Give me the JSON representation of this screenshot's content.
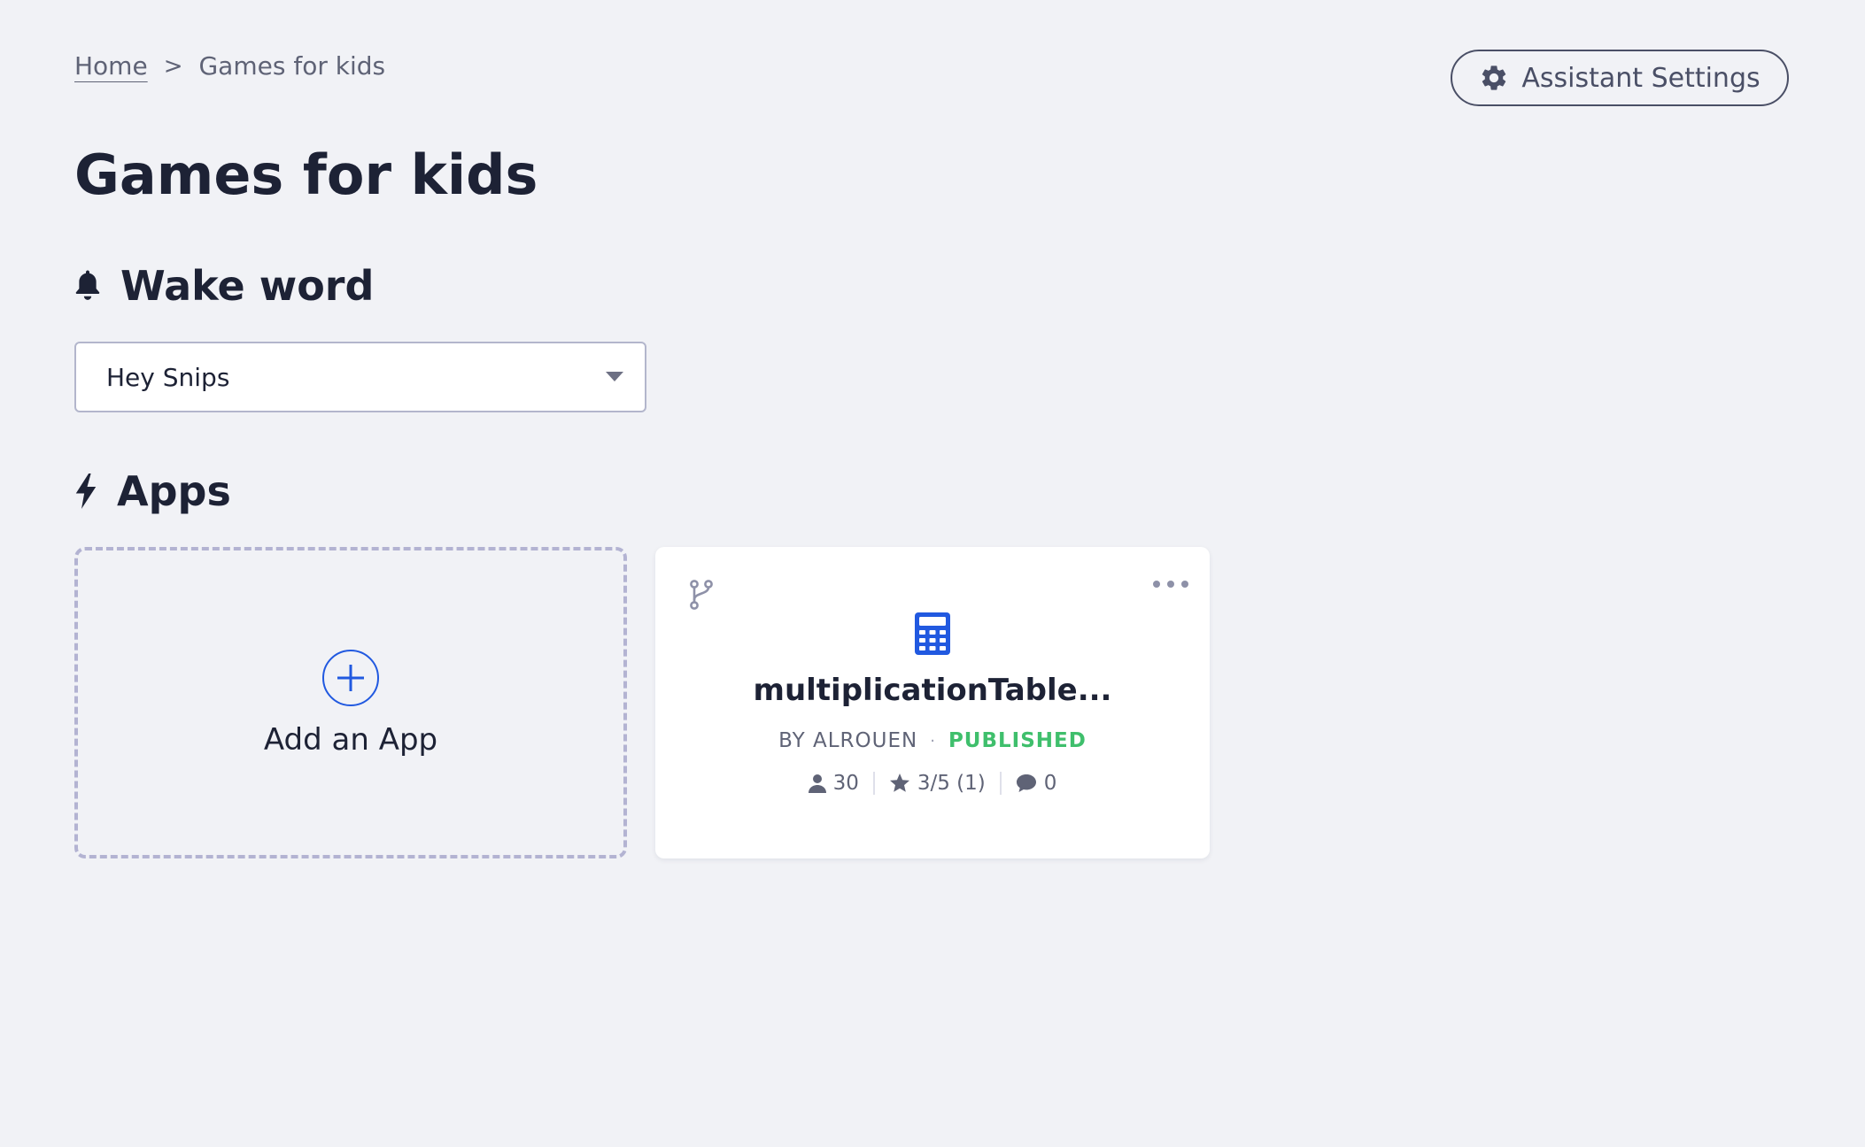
{
  "breadcrumb": {
    "home": "Home",
    "separator": ">",
    "current": "Games for kids"
  },
  "header": {
    "settings_label": "Assistant Settings",
    "settings_icon": "gear-icon"
  },
  "page": {
    "title": "Games for kids"
  },
  "wake_word": {
    "heading": "Wake word",
    "heading_icon": "bell-icon",
    "selected": "Hey Snips"
  },
  "apps": {
    "heading": "Apps",
    "heading_icon": "lightning-icon",
    "add_label": "Add an App",
    "items": [
      {
        "name": "multiplicationTable...",
        "author": "BY ALROUEN",
        "separator": "·",
        "status": "PUBLISHED",
        "installs": "30",
        "rating": "3/5 (1)",
        "comments": "0",
        "icon": "calculator-icon"
      }
    ]
  },
  "colors": {
    "background": "#f1f2f6",
    "text_dark": "#1d2235",
    "text_muted": "#5f6376",
    "accent_blue": "#2159e0",
    "published_green": "#3fbf6c",
    "dashed_border": "#b3b3d2"
  }
}
